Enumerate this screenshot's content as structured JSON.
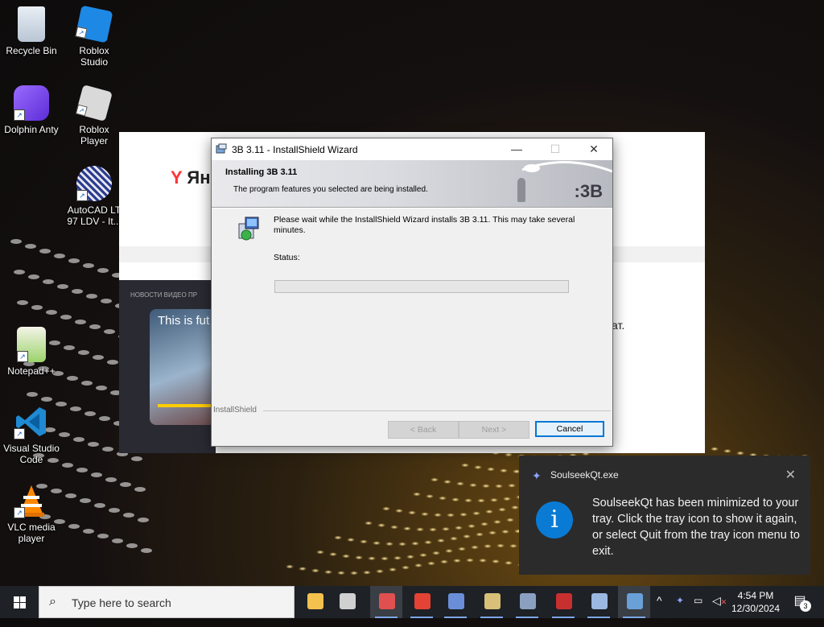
{
  "desktop": {
    "icons": [
      {
        "label": "Recycle Bin",
        "icon": "recycle-bin-icon"
      },
      {
        "label": "Roblox Studio",
        "icon": "roblox-studio-icon"
      },
      {
        "label": "Dolphin Anty",
        "icon": "dolphin-anty-icon"
      },
      {
        "label": "Roblox Player",
        "icon": "roblox-player-icon"
      },
      {
        "label": "AutoCAD LT 97 LDV - It...",
        "icon": "autocad-icon"
      },
      {
        "label": "Notepad++",
        "icon": "notepad-plus-icon"
      },
      {
        "label": "Visual Studio Code",
        "icon": "vscode-icon"
      },
      {
        "label": "VLC media player",
        "icon": "vlc-icon"
      }
    ]
  },
  "browser": {
    "logo_letter": "Y",
    "logo_text": "Ян",
    "news_tabs": "НОВОСТИ   ВИДЕО ПР",
    "video_caption": "This is fut",
    "side_text": "ат."
  },
  "installer": {
    "window_title": "3B 3.11 - InstallShield Wizard",
    "banner_heading": "Installing 3B 3.11",
    "banner_subtitle": "The program features you selected are being installed.",
    "brand": ":3B",
    "message": "Please wait while the InstallShield Wizard installs 3B 3.11. This may take several minutes.",
    "status_label": "Status:",
    "progress_fraction": 0.0,
    "footer_brand": "InstallShield",
    "buttons": {
      "back": "< Back",
      "next": "Next >",
      "cancel": "Cancel"
    },
    "controls": {
      "minimize": "—",
      "maximize": "☐",
      "close": "✕"
    }
  },
  "notification": {
    "app": "SoulseekQt.exe",
    "close": "✕",
    "info_glyph": "i",
    "message": "SoulseekQt has been minimized to your tray. Click the tray icon to show it again, or select Quit from the tray icon menu to exit."
  },
  "taskbar": {
    "search_placeholder": "Type here to search",
    "apps": [
      {
        "icon": "file-explorer-icon",
        "color": "#f2c14e"
      },
      {
        "icon": "roblox-player-icon",
        "color": "#d0d0d0"
      },
      {
        "icon": "installer-box-icon",
        "color": "#e05050"
      },
      {
        "icon": "acrobat-icon",
        "color": "#e34234"
      },
      {
        "icon": "setup-icon",
        "color": "#6a8fd8"
      },
      {
        "icon": "setup-icon",
        "color": "#d8c078"
      },
      {
        "icon": "setup-icon",
        "color": "#8aa0c0"
      },
      {
        "icon": "red-app-icon",
        "color": "#c83030"
      },
      {
        "icon": "network-icon",
        "color": "#9ab8e0"
      },
      {
        "icon": "installshield-icon",
        "color": "#6aa0d8"
      }
    ],
    "tray": {
      "chevron": "^"
    },
    "time": "4:54 PM",
    "date": "12/30/2024",
    "notification_count": "3"
  }
}
